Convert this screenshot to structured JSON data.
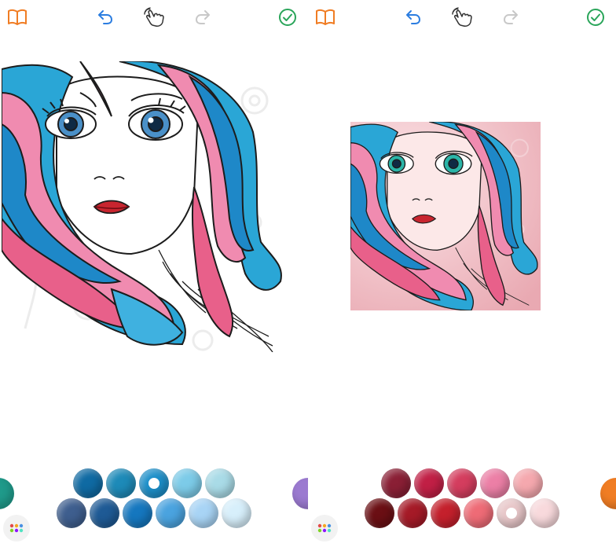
{
  "accent": "#f07d24",
  "left_screen": {
    "toolbar": {
      "book_icon": "book-icon",
      "undo_icon": "undo-icon",
      "finger_icon": "finger-tap-icon",
      "redo_icon": "redo-icon",
      "done_icon": "checkmark-circle-icon"
    },
    "palette": {
      "peek_left_color": "#1f9a8a",
      "peek_right_color": "#9b7ad0",
      "row1": [
        "#0f6aa3",
        "#1d8ab8",
        "#1c8fc9",
        "#7ccbe8",
        "#a9dbe7"
      ],
      "row2": [
        "#3e5e8e",
        "#1e5a95",
        "#1577bf",
        "#4aa3df",
        "#a8d4f5",
        "#d7effb"
      ],
      "selected_swatch": "row1-3"
    }
  },
  "right_screen": {
    "toolbar": {
      "book_icon": "book-icon",
      "undo_icon": "undo-icon",
      "finger_icon": "finger-tap-icon",
      "redo_icon": "redo-icon",
      "done_icon": "checkmark-circle-icon"
    },
    "palette": {
      "peek_right_color": "#f07d24",
      "row1": [
        "#8a1f35",
        "#c11f45",
        "#d43d5e",
        "#ec7fa6",
        "#f5a8ae"
      ],
      "row2": [
        "#6b0f14",
        "#a51a27",
        "#c4202c",
        "#ee6b76",
        "#e8c7c9",
        "#f8d9dc"
      ],
      "selected_swatch": "row2-5"
    }
  }
}
